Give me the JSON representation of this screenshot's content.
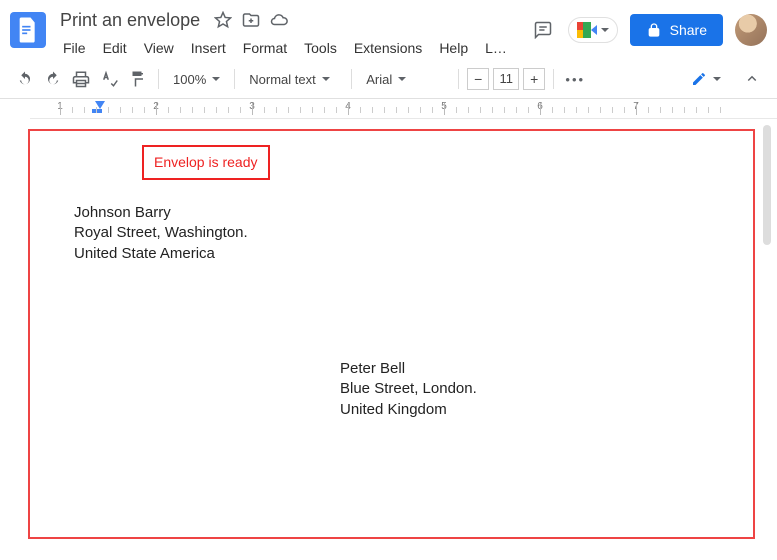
{
  "header": {
    "doc_title": "Print an envelope",
    "menus": [
      "File",
      "Edit",
      "View",
      "Insert",
      "Format",
      "Tools",
      "Extensions",
      "Help",
      "L…"
    ],
    "share_label": "Share"
  },
  "toolbar": {
    "zoom": "100%",
    "style": "Normal text",
    "font": "Arial",
    "font_size": "11"
  },
  "ruler": {
    "numbers": [
      "1",
      "2",
      "3",
      "4",
      "5",
      "6",
      "7"
    ]
  },
  "document": {
    "callout": "Envelop is ready",
    "sender": {
      "line1": "Johnson Barry",
      "line2": "Royal Street, Washington.",
      "line3": "United State America"
    },
    "recipient": {
      "line1": "Peter Bell",
      "line2": "Blue Street, London.",
      "line3": "United Kingdom"
    }
  }
}
